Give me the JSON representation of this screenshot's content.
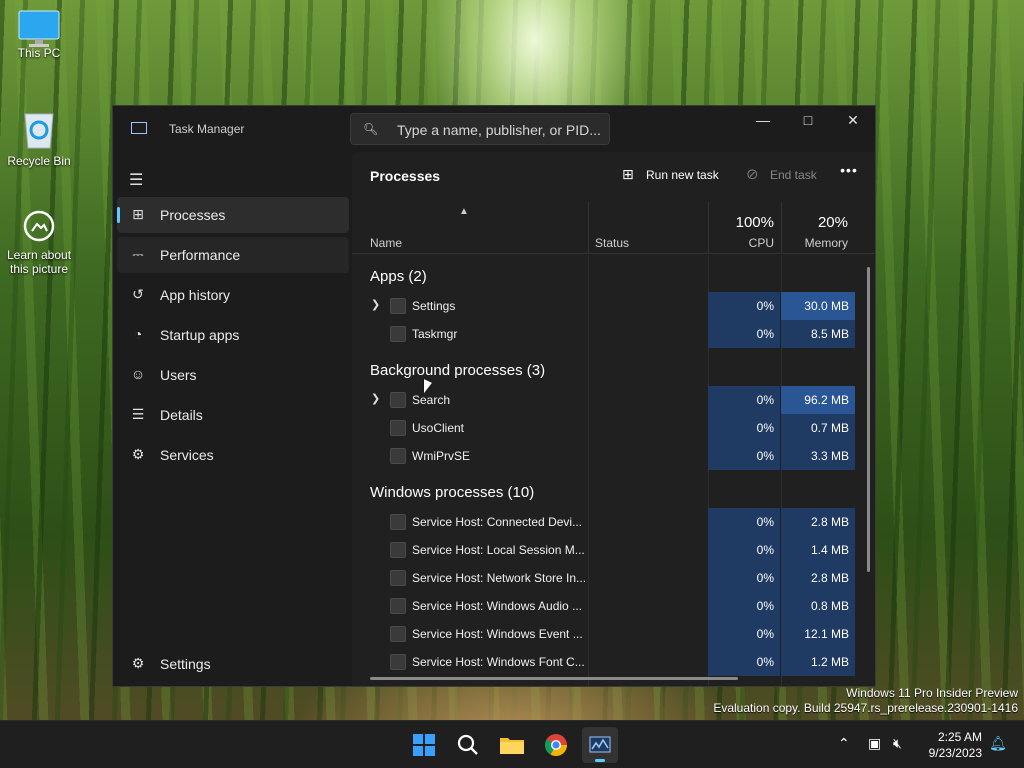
{
  "desktop": {
    "icons": [
      {
        "label": "This PC",
        "icon": "monitor-icon"
      },
      {
        "label": "Recycle Bin",
        "icon": "recycle-bin-icon"
      },
      {
        "label": "Learn about this picture",
        "icon": "camera-info-icon"
      }
    ],
    "watermark": {
      "line1": "Windows 11 Pro Insider Preview",
      "line2": "Evaluation copy. Build 25947.rs_prerelease.230901-1416"
    }
  },
  "task_manager": {
    "title": "Task Manager",
    "search_placeholder": "Type a name, publisher, or PID...",
    "nav": [
      {
        "label": "Processes",
        "icon": "processes-grid-icon",
        "selected": true
      },
      {
        "label": "Performance",
        "icon": "performance-chart-icon"
      },
      {
        "label": "App history",
        "icon": "history-icon"
      },
      {
        "label": "Startup apps",
        "icon": "startup-gauge-icon"
      },
      {
        "label": "Users",
        "icon": "users-icon"
      },
      {
        "label": "Details",
        "icon": "details-list-icon"
      },
      {
        "label": "Services",
        "icon": "services-puzzle-icon"
      }
    ],
    "settings_label": "Settings",
    "page_title": "Processes",
    "toolbar": {
      "run_new_task": "Run new task",
      "end_task": "End task"
    },
    "columns": {
      "name": "Name",
      "status": "Status",
      "cpu_pct": "100%",
      "cpu": "CPU",
      "mem_pct": "20%",
      "memory": "Memory"
    },
    "groups": [
      {
        "label": "Apps (2)",
        "rows": [
          {
            "name": "Settings",
            "expandable": true,
            "cpu": "0%",
            "memory": "30.0 MB",
            "hot": true
          },
          {
            "name": "Taskmgr",
            "expandable": false,
            "cpu": "0%",
            "memory": "8.5 MB",
            "hot": false
          }
        ]
      },
      {
        "label": "Background processes (3)",
        "rows": [
          {
            "name": "Search",
            "expandable": true,
            "cpu": "0%",
            "memory": "96.2 MB",
            "hot": true
          },
          {
            "name": "UsoClient",
            "expandable": false,
            "cpu": "0%",
            "memory": "0.7 MB",
            "hot": false
          },
          {
            "name": "WmiPrvSE",
            "expandable": false,
            "cpu": "0%",
            "memory": "3.3 MB",
            "hot": false
          }
        ]
      },
      {
        "label": "Windows processes (10)",
        "rows": [
          {
            "name": "Service Host: Connected Devi...",
            "expandable": false,
            "cpu": "0%",
            "memory": "2.8 MB",
            "hot": false
          },
          {
            "name": "Service Host: Local Session M...",
            "expandable": false,
            "cpu": "0%",
            "memory": "1.4 MB",
            "hot": false
          },
          {
            "name": "Service Host: Network Store In...",
            "expandable": false,
            "cpu": "0%",
            "memory": "2.8 MB",
            "hot": false
          },
          {
            "name": "Service Host: Windows Audio ...",
            "expandable": false,
            "cpu": "0%",
            "memory": "0.8 MB",
            "hot": false
          },
          {
            "name": "Service Host: Windows Event ...",
            "expandable": false,
            "cpu": "0%",
            "memory": "12.1 MB",
            "hot": false
          },
          {
            "name": "Service Host: Windows Font C...",
            "expandable": false,
            "cpu": "0%",
            "memory": "1.2 MB",
            "hot": false
          }
        ]
      }
    ]
  },
  "taskbar": {
    "apps": [
      "start-windows-icon",
      "search-icon",
      "file-explorer-icon",
      "chrome-icon",
      "task-manager-icon"
    ],
    "clock": {
      "time": "2:25 AM",
      "date": "9/23/2023"
    }
  },
  "colors": {
    "accent": "#60cdff",
    "cpu_cell": "#1f3a63",
    "mem_hot": "#2a5696"
  }
}
